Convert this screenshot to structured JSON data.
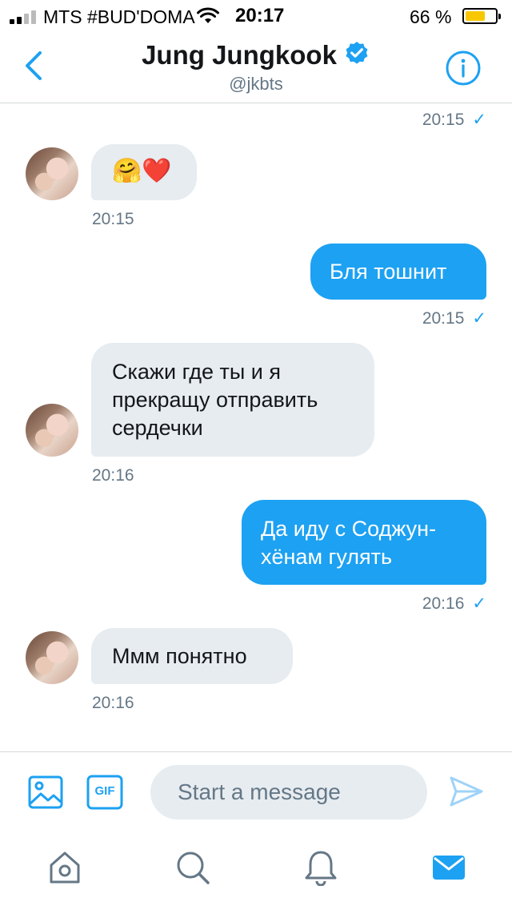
{
  "status_bar": {
    "carrier": "MTS #BUD'DOMA",
    "time": "20:17",
    "battery_percent": "66 %",
    "battery_level": 0.66
  },
  "header": {
    "name": "Jung Jungkook",
    "handle": "@jkbts"
  },
  "messages": [
    {
      "direction": "outgoing",
      "text": "",
      "time": "20:15",
      "check": "✓"
    },
    {
      "direction": "incoming",
      "text": "🤗❤️",
      "time": "20:15"
    },
    {
      "direction": "outgoing",
      "text": "Бля тошнит",
      "time": "20:15",
      "check": "✓"
    },
    {
      "direction": "incoming",
      "lines": [
        "Скажи где ты и я",
        "прекращу отправить",
        "сердечки"
      ],
      "time": "20:16"
    },
    {
      "direction": "outgoing",
      "lines": [
        "Да иду с Соджун-",
        "хёнам гулять"
      ],
      "time": "20:16",
      "check": "✓"
    },
    {
      "direction": "incoming",
      "text": "Ммм понятно",
      "time": "20:16"
    }
  ],
  "composer": {
    "placeholder": "Start a message",
    "gif_label": "GIF"
  },
  "colors": {
    "accent": "#1da1f2",
    "incoming_bubble": "#e6ecf0",
    "muted_text": "#657786"
  },
  "icons": {
    "back": "chevron-left-icon",
    "verified": "verified-badge-icon",
    "info": "info-icon",
    "media": "image-icon",
    "gif": "gif-icon",
    "send": "send-icon",
    "tabs": [
      "home-icon",
      "search-icon",
      "notifications-icon",
      "messages-icon"
    ]
  }
}
